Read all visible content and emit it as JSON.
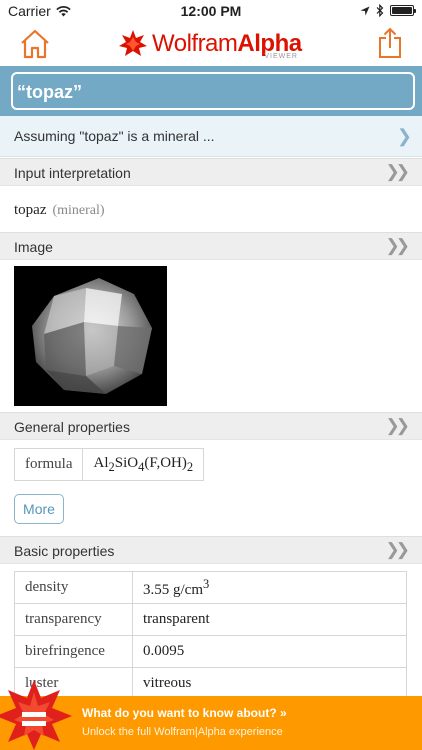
{
  "status_bar": {
    "carrier": "Carrier",
    "time": "12:00 PM"
  },
  "header": {
    "brand_main": "Wolfram",
    "brand_second": "Alpha",
    "brand_sub": "VIEWER"
  },
  "search": {
    "query": "“topaz”"
  },
  "assumption": {
    "text": "Assuming \"topaz\" is a mineral ..."
  },
  "pods": {
    "input_interpretation": {
      "title": "Input interpretation",
      "term": "topaz",
      "qualifier": "(mineral)"
    },
    "image": {
      "title": "Image"
    },
    "general_properties": {
      "title": "General properties",
      "formula_label": "formula",
      "formula_parts": {
        "al": "Al",
        "sub1": "2",
        "si": "SiO",
        "sub2": "4",
        "tail": "(F,OH)",
        "sub3": "2"
      },
      "more_label": "More"
    },
    "basic_properties": {
      "title": "Basic properties",
      "rows": [
        {
          "label": "density",
          "value": "3.55",
          "unit": "g/cm",
          "unit_sup": "3"
        },
        {
          "label": "transparency",
          "value": "transparent"
        },
        {
          "label": "birefringence",
          "value": "0.0095"
        },
        {
          "label": "luster",
          "value": "vitreous"
        }
      ]
    }
  },
  "banner": {
    "title": "What do you want to know about? »",
    "subtitle": "Unlock the full Wolfram|Alpha experience"
  },
  "colors": {
    "accent_orange": "#ff9900",
    "search_blue": "#73a9c4",
    "brand_red": "#dd1100"
  }
}
